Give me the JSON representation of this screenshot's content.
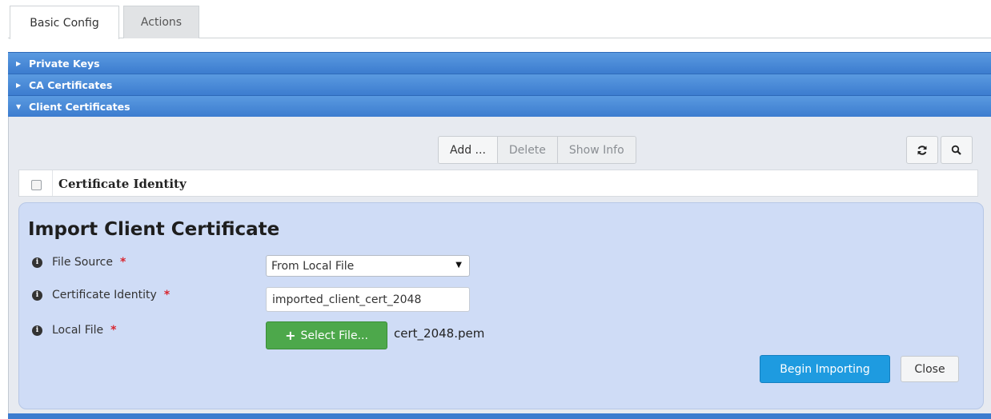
{
  "tabs": [
    {
      "label": "Basic Config",
      "active": true
    },
    {
      "label": "Actions",
      "active": false
    }
  ],
  "accordion": [
    {
      "label": "Private Keys",
      "expanded": false
    },
    {
      "label": "CA Certificates",
      "expanded": false
    },
    {
      "label": "Client Certificates",
      "expanded": true
    }
  ],
  "toolbar": {
    "add_label": "Add ...",
    "delete_label": "Delete",
    "show_info_label": "Show Info"
  },
  "table": {
    "columns": [
      "Certificate Identity"
    ]
  },
  "dialog": {
    "title": "Import Client Certificate",
    "fields": {
      "file_source": {
        "label": "File Source",
        "required": "*",
        "value": "From Local File"
      },
      "certificate_identity": {
        "label": "Certificate Identity",
        "required": "*",
        "value": "imported_client_cert_2048"
      },
      "local_file": {
        "label": "Local File",
        "required": "*",
        "button_label": "Select File...",
        "filename": "cert_2048.pem"
      }
    },
    "begin_label": "Begin Importing",
    "close_label": "Close"
  },
  "icons": {
    "info": "i",
    "plus": "+",
    "caret_down": "▼",
    "arrow_right": "▶",
    "arrow_down": "▼"
  },
  "colors": {
    "accordion": "#3c7ccf",
    "dialog_bg": "#cfdcf6",
    "select_file_button": "#4da84b",
    "begin_button": "#1e9be0",
    "required": "#d8262f"
  }
}
